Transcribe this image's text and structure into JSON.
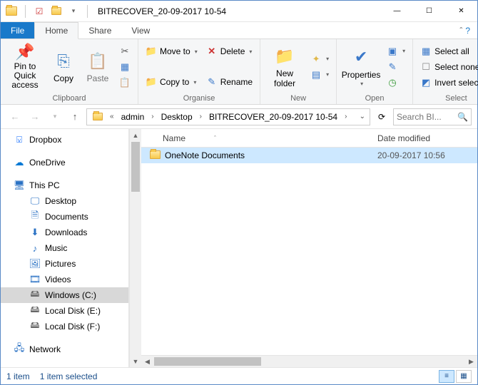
{
  "title": "BITRECOVER_20-09-2017 10-54",
  "ribbon_tabs": {
    "file": "File",
    "home": "Home",
    "share": "Share",
    "view": "View"
  },
  "ribbon": {
    "clipboard": {
      "label": "Clipboard",
      "pin": "Pin to Quick access",
      "copy": "Copy",
      "paste": "Paste",
      "cut": "",
      "copy_path": "",
      "paste_shortcut": ""
    },
    "organise": {
      "label": "Organise",
      "move_to": "Move to",
      "copy_to": "Copy to",
      "delete": "Delete",
      "rename": "Rename"
    },
    "new": {
      "label": "New",
      "new_folder": "New folder"
    },
    "open": {
      "label": "Open",
      "properties": "Properties"
    },
    "select": {
      "label": "Select",
      "select_all": "Select all",
      "select_none": "Select none",
      "invert": "Invert selection"
    }
  },
  "breadcrumb": [
    "admin",
    "Desktop",
    "BITRECOVER_20-09-2017 10-54"
  ],
  "search_placeholder": "Search BI...",
  "columns": {
    "name": "Name",
    "date": "Date modified"
  },
  "tree": {
    "dropbox": "Dropbox",
    "onedrive": "OneDrive",
    "thispc": "This PC",
    "desktop": "Desktop",
    "documents": "Documents",
    "downloads": "Downloads",
    "music": "Music",
    "pictures": "Pictures",
    "videos": "Videos",
    "winc": "Windows (C:)",
    "diske": "Local Disk (E:)",
    "diskf": "Local Disk (F:)",
    "network": "Network"
  },
  "rows": [
    {
      "name": "OneNote Documents",
      "date": "20-09-2017 10:56"
    }
  ],
  "status": {
    "count": "1 item",
    "selected": "1 item selected"
  }
}
